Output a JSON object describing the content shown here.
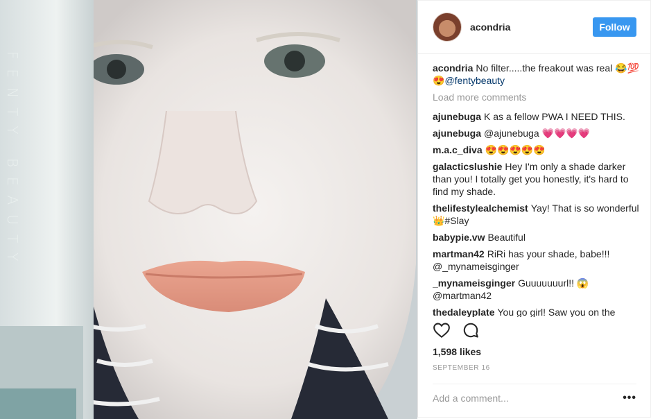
{
  "post": {
    "photo_alt_text": "FENTY BEAUTY"
  },
  "header": {
    "username": "acondria",
    "follow_label": "Follow"
  },
  "caption": {
    "username": "acondria",
    "text": "No filter.....the freakout was real 😂💯😍",
    "mention": "@fentybeauty"
  },
  "load_more_label": "Load more comments",
  "comments": [
    {
      "user": "ajunebuga",
      "text": "K as a fellow PWA I NEED THIS."
    },
    {
      "user": "ajunebuga",
      "text": "@ajunebuga 💗💗💗💗"
    },
    {
      "user": "m.a.c_diva",
      "text": "😍😍😍😍😍"
    },
    {
      "user": "galacticslushie",
      "text": "Hey I'm only a shade darker than you! I totally get you honestly, it's hard to find my shade."
    },
    {
      "user": "thelifestylealchemist",
      "text": "Yay! That is so wonderful 👑#Slay"
    },
    {
      "user": "babypie.vw",
      "text": "Beautiful"
    },
    {
      "user": "martman42",
      "text": "RiRi has your shade, babe!!! @_mynameisginger"
    },
    {
      "user": "_mynameisginger",
      "text": "Guuuuuuurl!! 😱 @martman42"
    },
    {
      "user": "thedaleyplate",
      "text": "You go girl! Saw you on the"
    }
  ],
  "likes": "1,598 likes",
  "date": "SEPTEMBER 16",
  "add_comment_placeholder": "Add a comment...",
  "more_label": "•••",
  "icons": {
    "like": "heart-icon",
    "comment": "speech-bubble-icon"
  },
  "colors": {
    "follow_button": "#3897f0",
    "secondary_text": "#999999",
    "mention": "#003569"
  }
}
